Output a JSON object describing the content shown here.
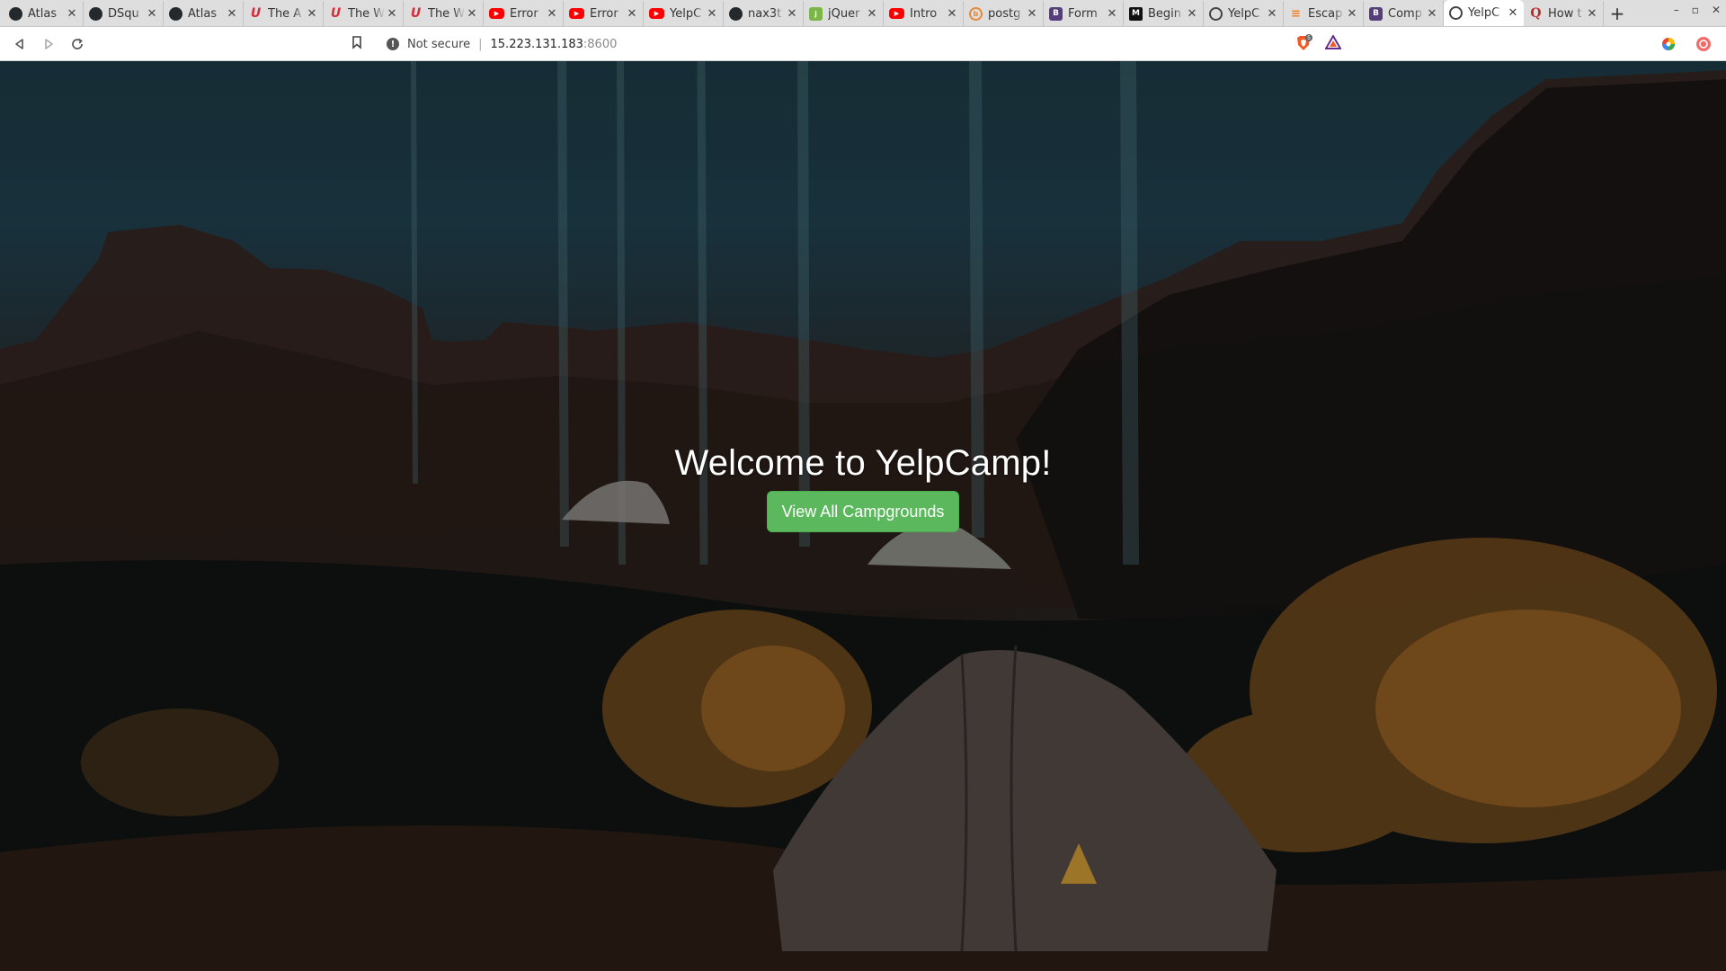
{
  "browser": {
    "tabs": [
      {
        "title": "Atlas",
        "icon": "github-icon",
        "glyph": ""
      },
      {
        "title": "DSqu",
        "icon": "github-icon",
        "glyph": ""
      },
      {
        "title": "Atlas",
        "icon": "github-icon",
        "glyph": ""
      },
      {
        "title": "The A",
        "icon": "udemy-icon",
        "glyph": "U"
      },
      {
        "title": "The W",
        "icon": "udemy-icon",
        "glyph": "U"
      },
      {
        "title": "The W",
        "icon": "udemy-icon",
        "glyph": "U"
      },
      {
        "title": "Error",
        "icon": "youtube-icon",
        "glyph": "▶"
      },
      {
        "title": "Error",
        "icon": "youtube-icon",
        "glyph": "▶"
      },
      {
        "title": "YelpC",
        "icon": "youtube-icon",
        "glyph": "▶"
      },
      {
        "title": "nax3t",
        "icon": "github-icon",
        "glyph": ""
      },
      {
        "title": "jQuer",
        "icon": "jquery-icon",
        "glyph": "j"
      },
      {
        "title": "Intro",
        "icon": "youtube-icon",
        "glyph": "▶"
      },
      {
        "title": "postg",
        "icon": "brave-icon",
        "glyph": "b"
      },
      {
        "title": "Form",
        "icon": "bootstrap-icon",
        "glyph": "B"
      },
      {
        "title": "Begin",
        "icon": "medium-icon",
        "glyph": "M"
      },
      {
        "title": "YelpC",
        "icon": "globe-icon",
        "glyph": ""
      },
      {
        "title": "Escap",
        "icon": "stackoverflow-icon",
        "glyph": "≡"
      },
      {
        "title": "Comp",
        "icon": "bootstrap-icon",
        "glyph": "B"
      },
      {
        "title": "YelpC",
        "icon": "globe-icon",
        "glyph": "",
        "active": true
      },
      {
        "title": "How t",
        "icon": "quora-icon",
        "glyph": "Q"
      }
    ],
    "address": {
      "security_label": "Not secure",
      "host": "15.223.131.183",
      "port": ":8600"
    },
    "shield_count": "5"
  },
  "page": {
    "heading": "Welcome to YelpCamp!",
    "cta_label": "View All Campgrounds",
    "cta_color": "#5cb85c"
  }
}
